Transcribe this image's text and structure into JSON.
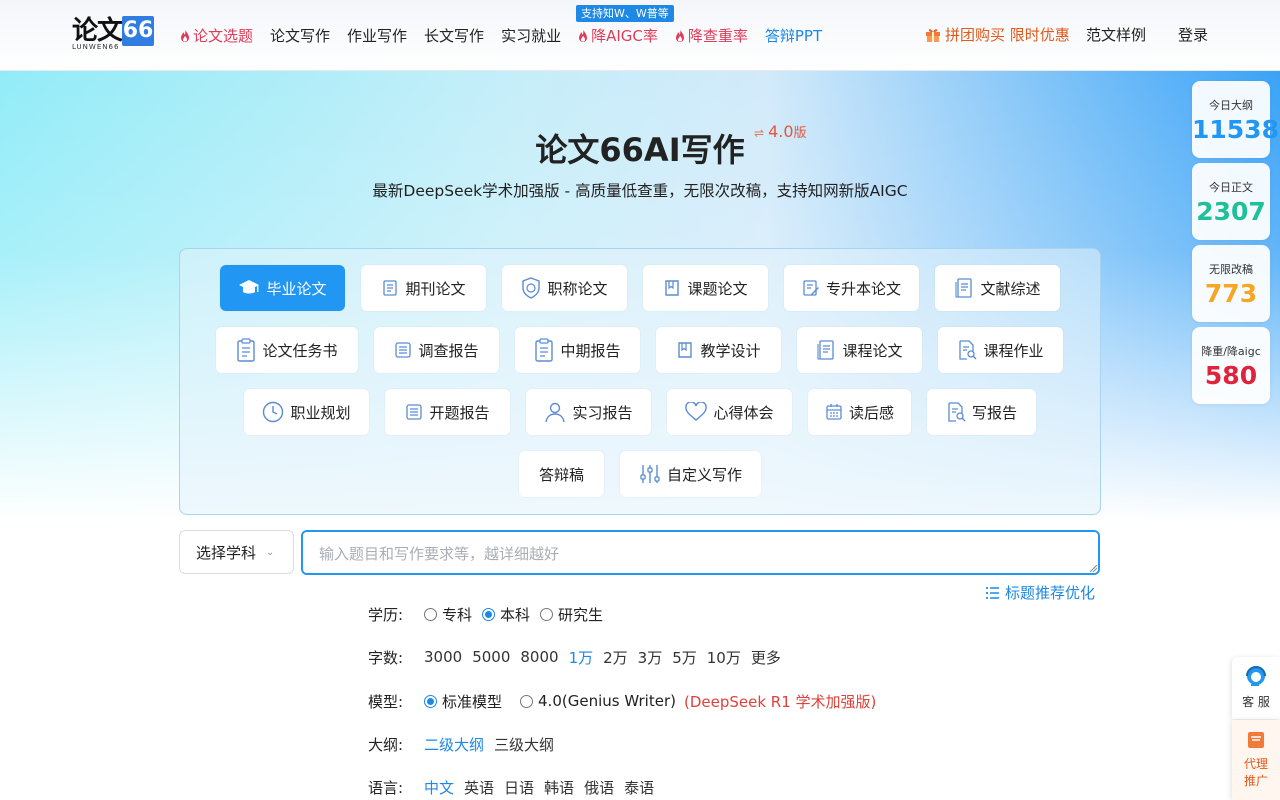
{
  "brand": {
    "logo_main": "论文",
    "logo_num": "66",
    "logo_sub": "LUNWEN66"
  },
  "nav": {
    "items": [
      {
        "label": "论文选题",
        "hot": true
      },
      {
        "label": "论文写作"
      },
      {
        "label": "作业写作"
      },
      {
        "label": "长文写作"
      },
      {
        "label": "实习就业"
      },
      {
        "label": "降AIGC率",
        "hot": true
      },
      {
        "label": "降查重率",
        "hot": true
      },
      {
        "label": "答辩PPT",
        "blue": true
      }
    ],
    "badge": "支持知W、W普等",
    "promo": "拼团购买 限时优惠",
    "samples": "范文样例",
    "login": "登录"
  },
  "hero": {
    "title": "论文66AI写作",
    "version_swap": "⇌",
    "version_num": "4.0",
    "version_suffix": "版",
    "subtitle": "最新DeepSeek学术加强版 - 高质量低查重，无限次改稿，支持知网新版AIGC"
  },
  "categories": [
    {
      "label": "毕业论文",
      "icon": "graduation-cap-icon",
      "active": true
    },
    {
      "label": "期刊论文",
      "icon": "journal-icon"
    },
    {
      "label": "职称论文",
      "icon": "shield-icon"
    },
    {
      "label": "课题论文",
      "icon": "book-icon"
    },
    {
      "label": "专升本论文",
      "icon": "edit-doc-icon"
    },
    {
      "label": "文献综述",
      "icon": "document-icon"
    },
    {
      "label": "论文任务书",
      "icon": "clipboard-icon"
    },
    {
      "label": "调查报告",
      "icon": "report-icon"
    },
    {
      "label": "中期报告",
      "icon": "clipboard-icon"
    },
    {
      "label": "教学设计",
      "icon": "book-icon"
    },
    {
      "label": "课程论文",
      "icon": "document-icon"
    },
    {
      "label": "课程作业",
      "icon": "search-doc-icon"
    },
    {
      "label": "职业规划",
      "icon": "clock-icon"
    },
    {
      "label": "开题报告",
      "icon": "report-icon"
    },
    {
      "label": "实习报告",
      "icon": "user-icon"
    },
    {
      "label": "心得体会",
      "icon": "heart-icon"
    },
    {
      "label": "读后感",
      "icon": "calendar-icon"
    },
    {
      "label": "写报告",
      "icon": "search-doc-icon"
    },
    {
      "label": "答辩稿",
      "icon": ""
    },
    {
      "label": "自定义写作",
      "icon": "sliders-icon"
    }
  ],
  "input": {
    "subject_label": "选择学科",
    "placeholder": "输入题目和写作要求等，越详细越好",
    "optimize_label": "标题推荐优化"
  },
  "form": {
    "education": {
      "label": "学历:",
      "options": [
        "专科",
        "本科",
        "研究生"
      ],
      "selected": "本科"
    },
    "word_count": {
      "label": "字数:",
      "options": [
        "3000",
        "5000",
        "8000",
        "1万",
        "2万",
        "3万",
        "5万",
        "10万",
        "更多"
      ],
      "selected": "1万"
    },
    "model": {
      "label": "模型:",
      "options": [
        "标准模型",
        "4.0(Genius Writer)"
      ],
      "selected": "标准模型",
      "note": "(DeepSeek R1 学术加强版)"
    },
    "outline": {
      "label": "大纲:",
      "options": [
        "二级大纲",
        "三级大纲"
      ],
      "selected": "二级大纲"
    },
    "language": {
      "label": "语言:",
      "options": [
        "中文",
        "英语",
        "日语",
        "韩语",
        "俄语",
        "泰语"
      ],
      "selected": "中文"
    }
  },
  "stats": [
    {
      "label": "今日大纲",
      "value": "11538",
      "color": "#2196f3"
    },
    {
      "label": "今日正文",
      "value": "2307",
      "color": "#1fbf9a"
    },
    {
      "label": "无限改稿",
      "value": "773",
      "color": "#f5a623"
    },
    {
      "label": "降重/降aigc",
      "value": "580",
      "color": "#e0233b"
    }
  ],
  "floating": {
    "service": "客 服",
    "agent_line1": "代理",
    "agent_line2": "推广"
  }
}
